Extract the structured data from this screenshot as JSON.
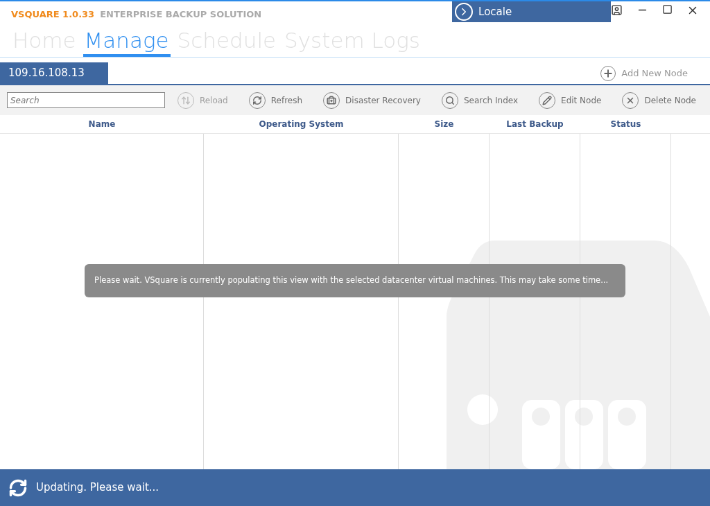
{
  "app": {
    "name": "VSQUARE 1.0.33",
    "subtitle": "ENTERPRISE BACKUP SOLUTION"
  },
  "locale": {
    "label": "Locale"
  },
  "tabs": [
    {
      "label": "Home",
      "selected": false
    },
    {
      "label": "Manage",
      "selected": true
    },
    {
      "label": "Schedule",
      "selected": false
    },
    {
      "label": "System Logs",
      "selected": false
    }
  ],
  "node_tabs": [
    {
      "label": "109.16.108.13",
      "selected": true
    }
  ],
  "add_node": {
    "label": "Add New Node"
  },
  "search": {
    "placeholder": "Search"
  },
  "toolbar": [
    {
      "kind": "reload",
      "label": "Reload",
      "disabled": true
    },
    {
      "kind": "refresh",
      "label": "Refresh",
      "disabled": false
    },
    {
      "kind": "recovery",
      "label": "Disaster Recovery",
      "disabled": false
    },
    {
      "kind": "search",
      "label": "Search Index",
      "disabled": false
    },
    {
      "kind": "edit",
      "label": "Edit Node",
      "disabled": false
    },
    {
      "kind": "delete",
      "label": "Delete Node",
      "disabled": false
    }
  ],
  "table": {
    "columns": [
      "Name",
      "Operating System",
      "Size",
      "Last Backup",
      "Status"
    ]
  },
  "message": "Please wait. VSquare is currently populating this view with the selected datacenter virtual machines. This may take some time...",
  "status_bar": {
    "text": "Updating. Please wait..."
  }
}
